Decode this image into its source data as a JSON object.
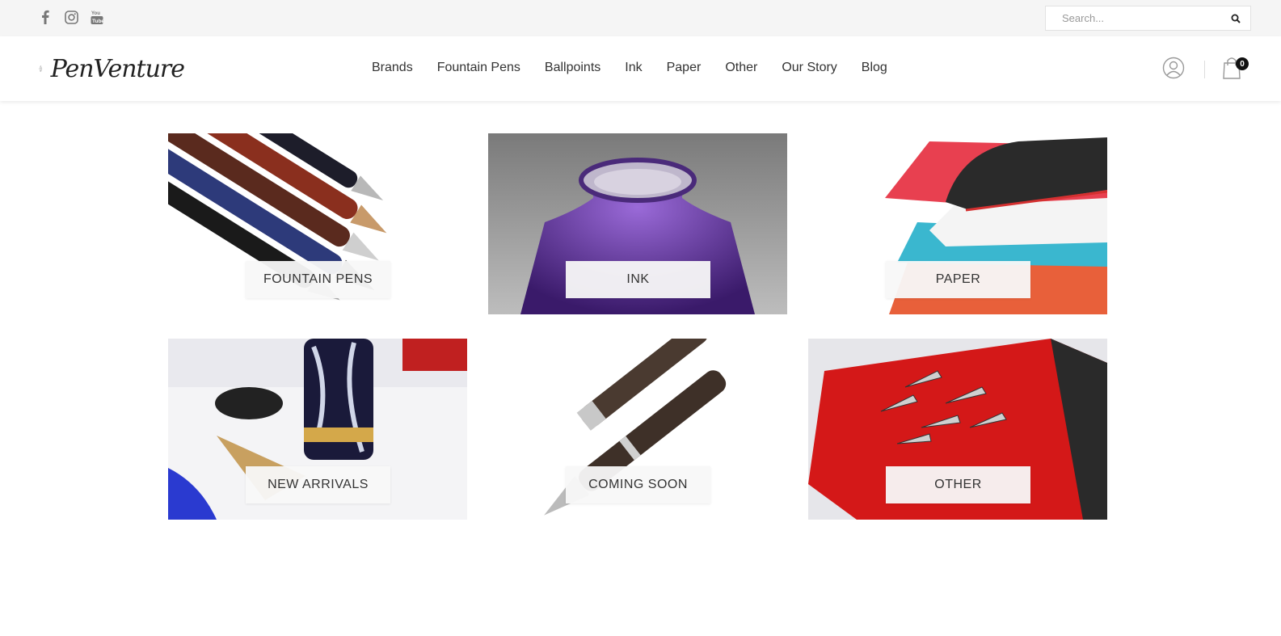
{
  "topbar": {
    "social": [
      {
        "name": "facebook-icon",
        "glyph": "f"
      },
      {
        "name": "instagram-icon",
        "glyph": "◎"
      },
      {
        "name": "youtube-icon",
        "glyph": "You Tube"
      }
    ],
    "search": {
      "placeholder": "Search..."
    }
  },
  "header": {
    "logo_text": "PenVenture",
    "nav": [
      "Brands",
      "Fountain Pens",
      "Ballpoints",
      "Ink",
      "Paper",
      "Other",
      "Our Story",
      "Blog"
    ],
    "cart_count": "0"
  },
  "tiles": [
    {
      "label": "FOUNTAIN PENS"
    },
    {
      "label": "INK"
    },
    {
      "label": "PAPER"
    },
    {
      "label": "NEW ARRIVALS"
    },
    {
      "label": "COMING SOON"
    },
    {
      "label": "OTHER"
    }
  ]
}
